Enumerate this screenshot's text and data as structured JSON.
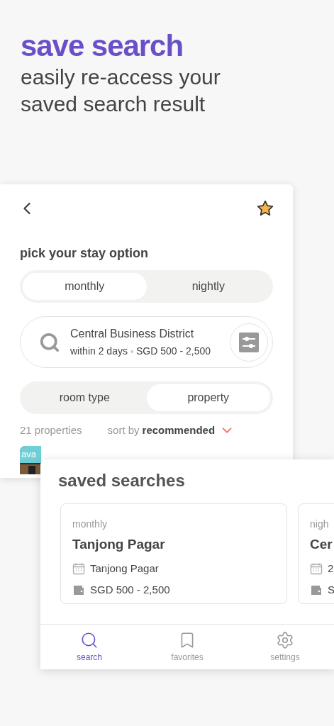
{
  "header": {
    "title": "save search",
    "subtitle": "easily re-access your saved search result"
  },
  "search_screen": {
    "stay_label": "pick your stay option",
    "stay_options": [
      {
        "label": "monthly",
        "selected": true
      },
      {
        "label": "nightly",
        "selected": false
      }
    ],
    "search": {
      "location": "Central Business District",
      "when": "within 2 days",
      "price": "SGD 500 - 2,500"
    },
    "view_options": [
      {
        "label": "room type",
        "selected": false
      },
      {
        "label": "property",
        "selected": true
      }
    ],
    "result_count": "21 properties",
    "sort_label": "sort by",
    "sort_value": "recommended",
    "listing_badge": "ava"
  },
  "saved_searches": {
    "title": "saved searches",
    "items": [
      {
        "stay": "monthly",
        "name": "Tanjong Pagar",
        "detail": "Tanjong Pagar",
        "price": "SGD 500 - 2,500"
      },
      {
        "stay": "nigh",
        "name": "Cer",
        "detail": "2",
        "price": "S"
      }
    ]
  },
  "nav": [
    {
      "kind": "search",
      "label": "search",
      "selected": true
    },
    {
      "kind": "favorites",
      "label": "favorites",
      "selected": false
    },
    {
      "kind": "settings",
      "label": "settings",
      "selected": false
    }
  ]
}
